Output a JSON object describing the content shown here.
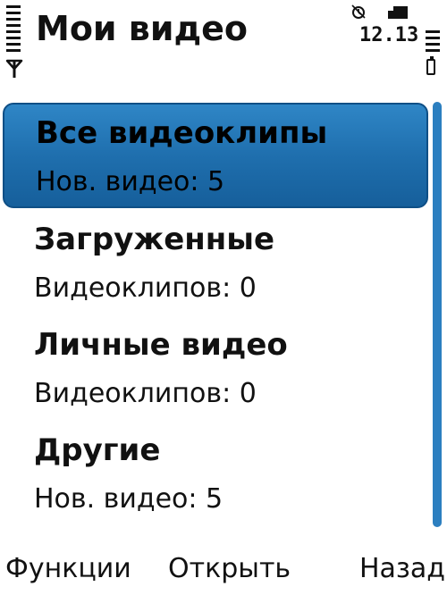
{
  "header": {
    "title": "Мои видео",
    "clock": "12.13"
  },
  "list": {
    "selected_index": 0,
    "items": [
      {
        "title": "Все видеоклипы",
        "subtitle": "Нов. видео: 5"
      },
      {
        "title": "Загруженные",
        "subtitle": "Видеоклипов: 0"
      },
      {
        "title": "Личные видео",
        "subtitle": "Видеоклипов: 0"
      },
      {
        "title": "Другие",
        "subtitle": "Нов. видео: 5"
      }
    ]
  },
  "softkeys": {
    "left": "Функции",
    "center": "Открыть",
    "right": "Назад"
  },
  "colors": {
    "highlight": "#1f6fae",
    "scrollbar": "#2c7fc0",
    "background": "#ffffff",
    "text": "#111111"
  },
  "icons": {
    "signal": "signal-strength-icon",
    "antenna": "antenna-icon",
    "alarm": "alarm-clock-icon",
    "sim": "sim-card-icon",
    "battery": "battery-icon"
  }
}
